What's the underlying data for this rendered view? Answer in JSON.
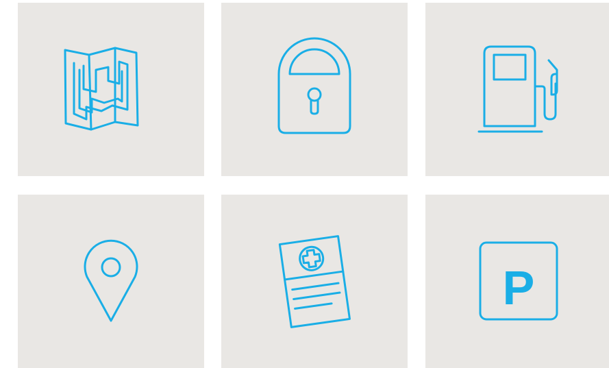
{
  "icons": [
    {
      "name": "map-icon"
    },
    {
      "name": "lock-icon"
    },
    {
      "name": "fuel-pump-icon"
    },
    {
      "name": "location-pin-icon"
    },
    {
      "name": "medical-document-icon"
    },
    {
      "name": "parking-sign-icon",
      "letter": "P"
    }
  ],
  "colors": {
    "tile_background": "#e9e7e4",
    "icon_stroke": "#1aaee6",
    "page_background": "#ffffff"
  }
}
